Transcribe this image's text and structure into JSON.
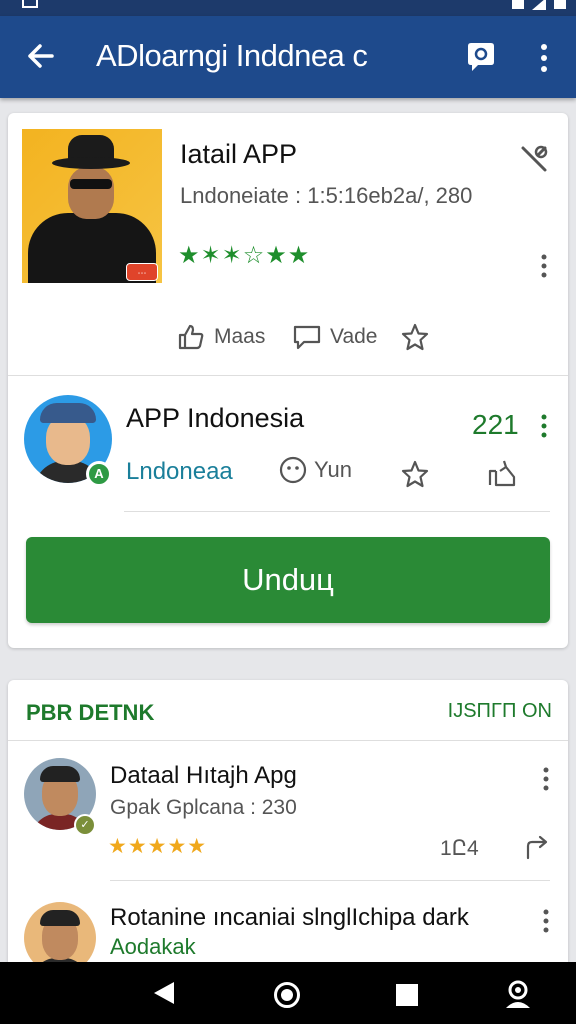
{
  "app_bar": {
    "title": "ADloarngi Inddnea c",
    "back_icon": "arrow-back-icon",
    "chat_icon": "chat-bubble-icon",
    "more_icon": "more-vert-icon"
  },
  "detail_card": {
    "title": "Iatail APP",
    "subtitle": "Lndoneiate : 1:5:16eb2a/, 280",
    "stars": "★✶✶☆★★",
    "actions": {
      "like_label": "Maas",
      "comment_label": "Vade"
    }
  },
  "app_row": {
    "title": "APP Indonesia",
    "badge": "A",
    "subtitle": "Lndoneaa",
    "count": "221",
    "face_label": "Yun"
  },
  "download_button": {
    "label": "Unduц"
  },
  "section": {
    "title": "PBR DETNK",
    "action": "IJSΠΓΠ ON",
    "items": [
      {
        "title": "Dataal Hıtajh Apg",
        "subtitle": "Gpak Gplcana : 230",
        "stars": "★★★★★",
        "count": "1Ը4"
      },
      {
        "title": "Rotanine ıncaniai slnglIchipa dark",
        "subtitle": "Aodakak"
      }
    ]
  },
  "colors": {
    "app_bar": "#1e4a8c",
    "accent_green": "#2a8a36",
    "star_yellow": "#f0a81c"
  }
}
